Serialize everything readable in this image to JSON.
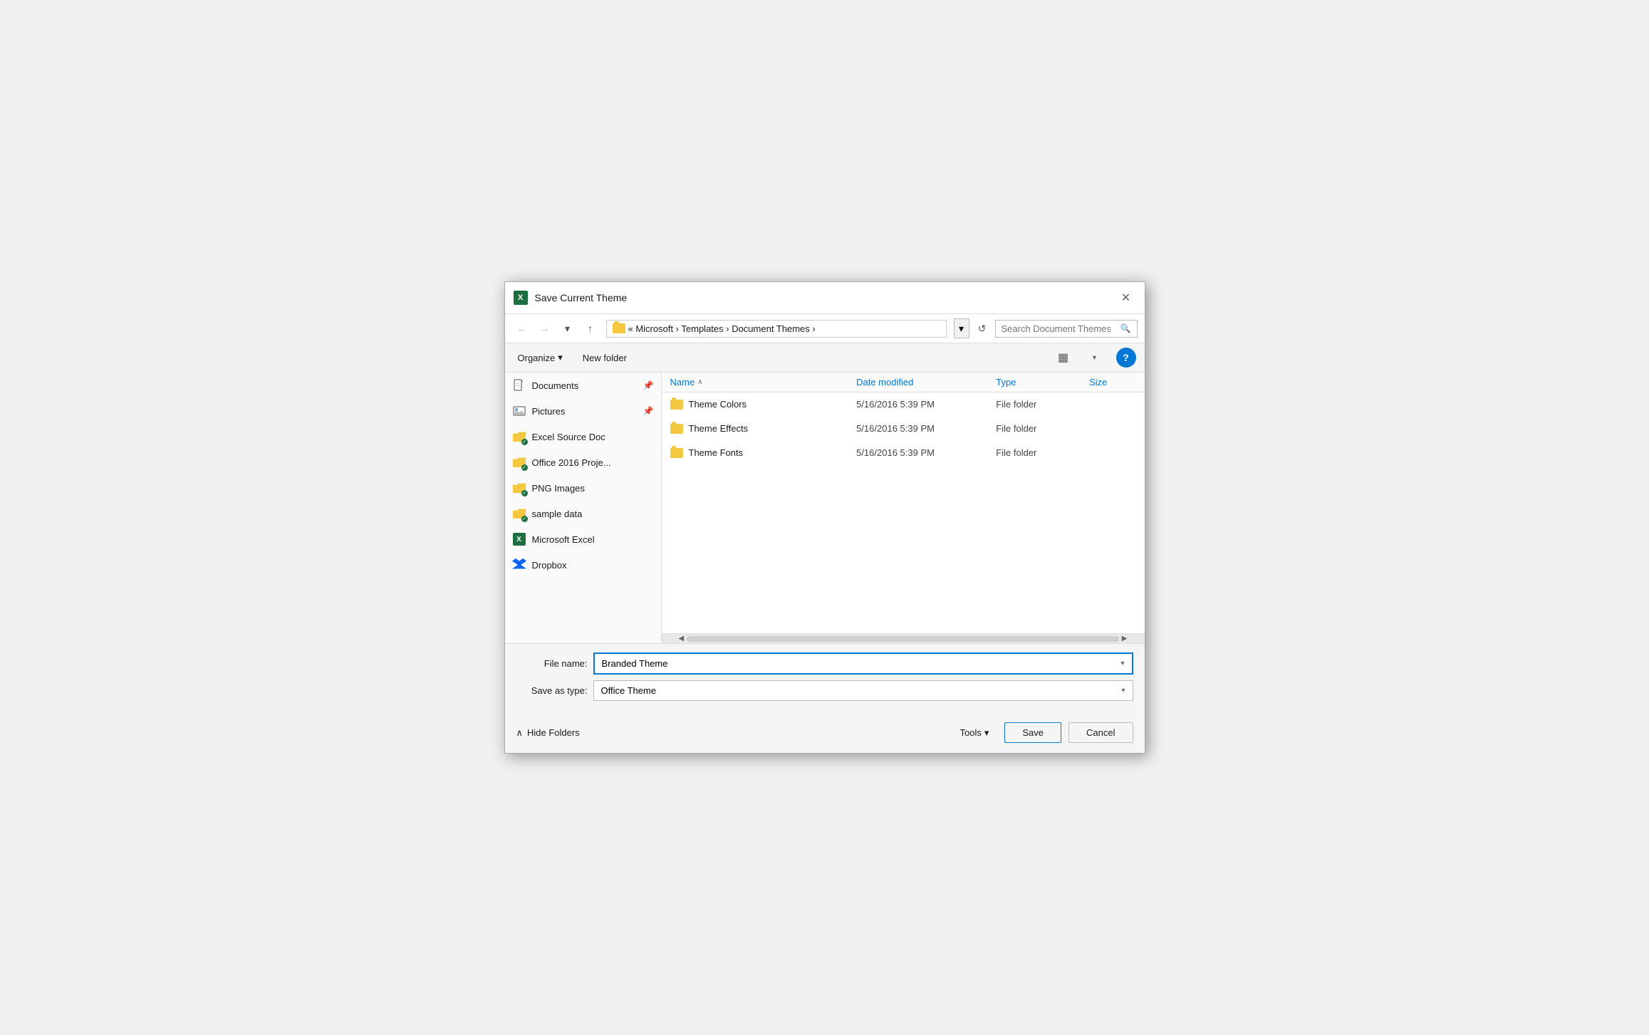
{
  "dialog": {
    "title": "Save Current Theme",
    "icon_label": "X"
  },
  "nav": {
    "back_label": "←",
    "forward_label": "→",
    "dropdown_label": "▾",
    "up_label": "↑",
    "breadcrumb": "« Microsoft  ›  Templates  ›  Document Themes  ›",
    "refresh_label": "↺",
    "search_placeholder": "Search Document Themes",
    "search_icon": "🔍"
  },
  "toolbar": {
    "organize_label": "Organize",
    "organize_chevron": "▾",
    "new_folder_label": "New folder",
    "view_icon": "▦",
    "view_chevron": "▾",
    "help_label": "?"
  },
  "sidebar": {
    "items": [
      {
        "id": "documents",
        "label": "Documents",
        "icon": "doc",
        "pinned": true
      },
      {
        "id": "pictures",
        "label": "Pictures",
        "icon": "pic",
        "pinned": true
      },
      {
        "id": "excel-source-doc",
        "label": "Excel Source Doc",
        "icon": "folder-badge"
      },
      {
        "id": "office-2016",
        "label": "Office 2016 Proje...",
        "icon": "folder-badge"
      },
      {
        "id": "png-images",
        "label": "PNG Images",
        "icon": "folder-badge"
      },
      {
        "id": "sample-data",
        "label": "sample data",
        "icon": "folder-badge"
      },
      {
        "id": "microsoft-excel",
        "label": "Microsoft Excel",
        "icon": "excel"
      },
      {
        "id": "dropbox",
        "label": "Dropbox",
        "icon": "dropbox"
      }
    ]
  },
  "file_list": {
    "columns": {
      "name": "Name",
      "date_modified": "Date modified",
      "type": "Type",
      "size": "Size"
    },
    "rows": [
      {
        "id": "theme-colors",
        "name": "Theme Colors",
        "date_modified": "5/16/2016 5:39 PM",
        "type": "File folder",
        "size": ""
      },
      {
        "id": "theme-effects",
        "name": "Theme Effects",
        "date_modified": "5/16/2016 5:39 PM",
        "type": "File folder",
        "size": ""
      },
      {
        "id": "theme-fonts",
        "name": "Theme Fonts",
        "date_modified": "5/16/2016 5:39 PM",
        "type": "File folder",
        "size": ""
      }
    ]
  },
  "form": {
    "file_name_label": "File name:",
    "file_name_value": "Branded Theme",
    "save_as_type_label": "Save as type:",
    "save_as_type_value": "Office Theme"
  },
  "footer": {
    "hide_folders_label": "Hide Folders",
    "hide_folders_chevron": "∧",
    "tools_label": "Tools",
    "tools_chevron": "▾",
    "save_label": "Save",
    "cancel_label": "Cancel"
  }
}
